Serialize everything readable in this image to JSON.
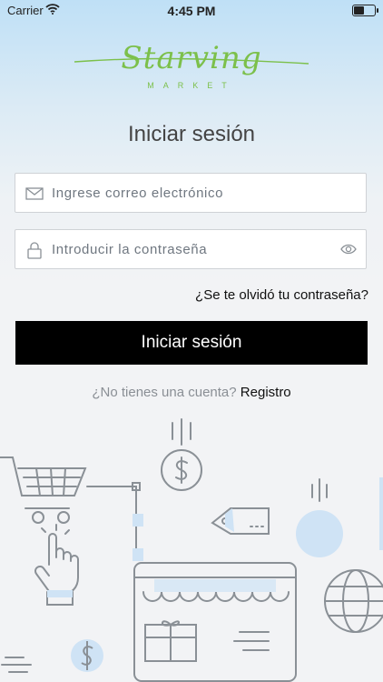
{
  "status_bar": {
    "carrier": "Carrier",
    "time": "4:45 PM"
  },
  "logo": {
    "script": "Starving",
    "sub": "MARKET"
  },
  "title": "Iniciar sesión",
  "email": {
    "placeholder": "Ingrese correo electrónico",
    "value": ""
  },
  "password": {
    "placeholder": "Introducir la contraseña",
    "value": ""
  },
  "forgot_link": "¿Se te olvidó tu contraseña?",
  "login_button": "Iniciar sesión",
  "signup": {
    "question": "¿No tienes una cuenta?",
    "link": "Registro"
  },
  "colors": {
    "brand_green": "#7cc04b",
    "button_bg": "#000000",
    "illustration_line": "#8a9096",
    "illustration_accent": "#cfe3f5"
  }
}
